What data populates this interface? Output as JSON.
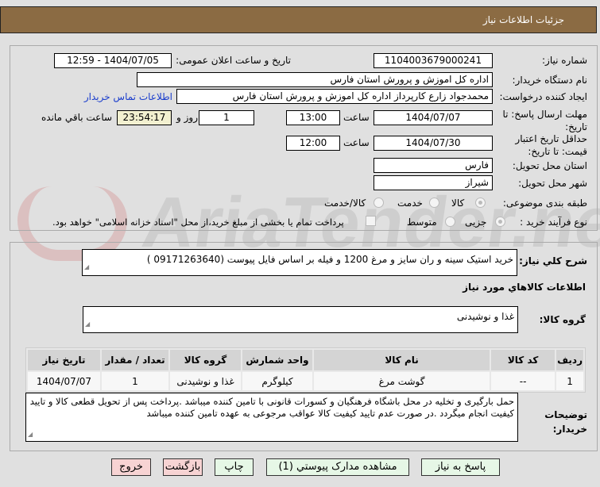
{
  "header": {
    "title": "جزئیات اطلاعات نیاز"
  },
  "watermark": "AriaTender.net",
  "form": {
    "need_number_label": "شماره نیاز:",
    "need_number": "1104003679000241",
    "announce_label": "تاریخ و ساعت اعلان عمومی:",
    "announce_value": "1404/07/05 - 12:59",
    "buyer_label": "نام دستگاه خریدار:",
    "buyer_value": "اداره کل اموزش و پرورش استان فارس",
    "creator_label": "ایجاد کننده درخواست:",
    "creator_value": "محمدجواد زارع کارپرداز اداره کل اموزش و پرورش استان فارس",
    "contact_link": "اطلاعات تماس خریدار",
    "deadline_label": "مهلت ارسال پاسخ: تا تاریخ:",
    "deadline_date": "1404/07/07",
    "time_label": "ساعت",
    "deadline_time": "13:00",
    "days": "1",
    "days_label": "روز و",
    "remaining": "23:54:17",
    "remaining_label": "ساعت باقي مانده",
    "validity_label": "حداقل تاریخ اعتبار قیمت: تا تاریخ:",
    "validity_date": "1404/07/30",
    "validity_time": "12:00",
    "province_label": "استان محل تحویل:",
    "province": "فارس",
    "city_label": "شهر محل تحویل:",
    "city": "شیراز",
    "category_label": "طبقه بندی موضوعی:",
    "category_options": [
      "کالا",
      "خدمت",
      "کالا/خدمت"
    ],
    "process_label": "نوع فرآیند خرید :",
    "process_options": [
      "جزیی",
      "متوسط"
    ],
    "payment_note": "پرداخت تمام یا بخشی از مبلغ خرید،از محل \"اسناد خزانه اسلامی\" خواهد بود."
  },
  "details": {
    "summary_label": "شرح کلي نياز:",
    "summary": "خرید استیک سینه و ران سایز و مرغ 1200 و فیله بر اساس فایل پیوست (09171263640 )",
    "goods_title": "اطلاعات کالاهاي مورد نياز",
    "group_label": "گروه کالا:",
    "group": "غذا و نوشیدنی",
    "table": {
      "headers": [
        "ردیف",
        "کد کالا",
        "نام کالا",
        "واحد شمارش",
        "گروه کالا",
        "تعداد / مقدار",
        "تاریخ نیاز"
      ],
      "rows": [
        [
          "1",
          "--",
          "گوشت مرغ",
          "کیلوگرم",
          "غذا و نوشیدنی",
          "1",
          "1404/07/07"
        ]
      ]
    },
    "notes_label": "توضیحات خریدار:",
    "notes": "حمل بارگیری و تخلیه در محل باشگاه فرهنگیان و کسورات قانونی با تامین کننده میباشد .پرداخت پس از تحویل قطعی کالا و تایید کیفیت انجام میگردد .در صورت عدم تایید کیفیت کالا عواقب مرجوعی به عهده تامین کننده میباشد"
  },
  "buttons": {
    "reply": "پاسخ به نیاز",
    "attachments": "مشاهده مدارک پیوستي (1)",
    "print": "چاپ",
    "back": "بازگشت",
    "exit": "خروج"
  }
}
